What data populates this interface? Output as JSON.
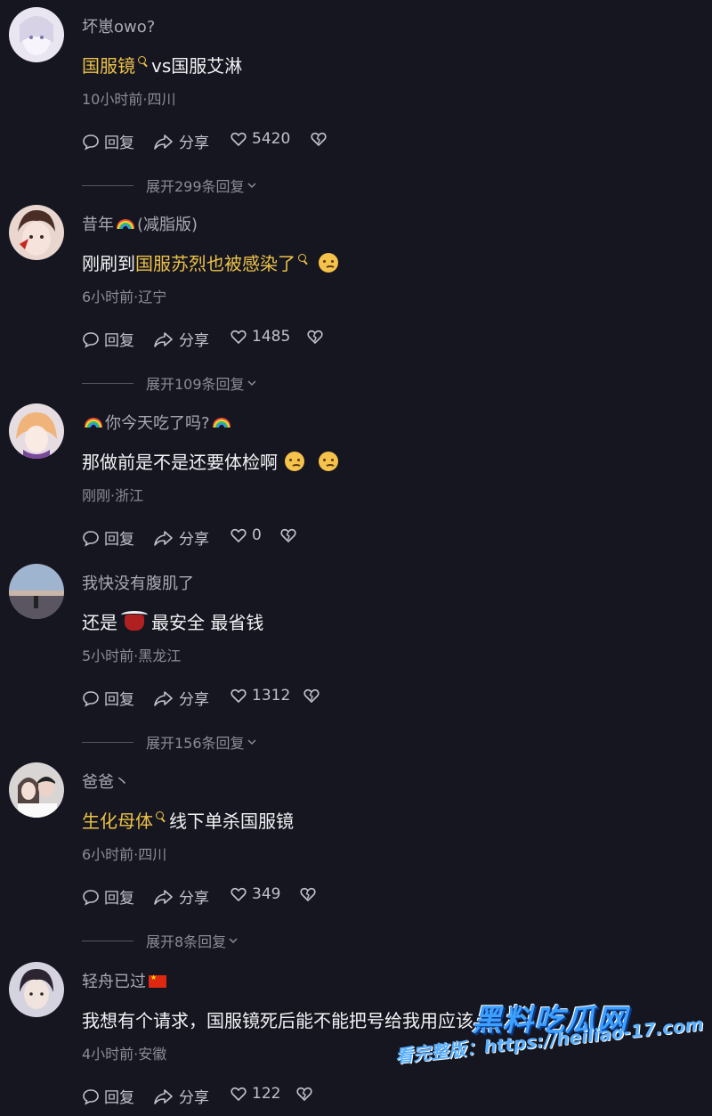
{
  "colors": {
    "background": "#161620",
    "highlight": "#ecc24a",
    "text": "#f2f2f5",
    "muted": "#8c8c98"
  },
  "actions": {
    "reply": "回复",
    "share": "分享"
  },
  "comments": [
    {
      "username": "坏崽owo?",
      "text_highlight": "国服镜",
      "text": "vs国服艾淋",
      "meta": "10小时前·四川",
      "likes": "5420",
      "expand": "展开299条回复"
    },
    {
      "username_pre": "昔年",
      "username": "(减脂版)",
      "text_pre": "刚刷到",
      "text_highlight": "国服苏烈也被感染了",
      "meta": "6小时前·辽宁",
      "likes": "1485",
      "expand": "展开109条回复"
    },
    {
      "username": "你今天吃了吗?",
      "text": "那做前是不是还要体检啊",
      "meta": "刚刚·浙江",
      "likes": "0"
    },
    {
      "username": "我快没有腹肌了",
      "text_pre": "还是",
      "text": "最安全 最省钱",
      "meta": "5小时前·黑龙江",
      "likes": "1312",
      "expand": "展开156条回复"
    },
    {
      "username": "爸爸丶",
      "text_highlight": "生化母体",
      "text": "线下单杀国服镜",
      "meta": "6小时前·四川",
      "likes": "349",
      "expand": "展开8条回复"
    },
    {
      "username": "轻舟已过",
      "text": "我想有个请求，国服镜死后能不能把号给我用应该",
      "meta": "4小时前·安徽",
      "likes": "122"
    }
  ],
  "watermark": {
    "title": "黑料吃瓜网",
    "url_line": "看完整版：https://heiliao-17.com"
  }
}
